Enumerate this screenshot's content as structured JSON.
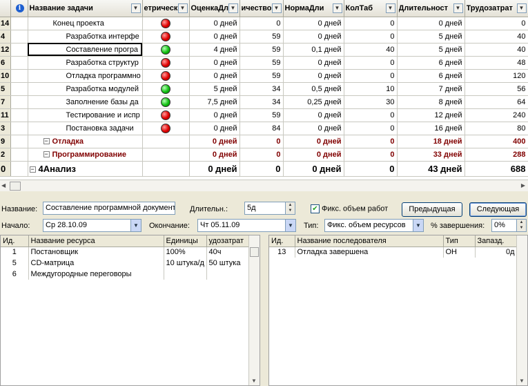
{
  "grid": {
    "columns": [
      {
        "label": ""
      },
      {
        "label": ""
      },
      {
        "label": "Название задачи"
      },
      {
        "label": "етрическ"
      },
      {
        "label": "ОценкаДл"
      },
      {
        "label": "ичествоР"
      },
      {
        "label": "НормаДли"
      },
      {
        "label": "КолТаб"
      },
      {
        "label": "Длительност"
      },
      {
        "label": "Трудозатрат"
      }
    ],
    "rows": [
      {
        "id": "14",
        "name": "Конец проекта",
        "indicator": "red",
        "ocenka": "0 дней",
        "kolichestvo": "0",
        "norma": "0 дней",
        "koltab": "0",
        "dlit": "0 дней",
        "trud": "0",
        "level": 1,
        "type": "task"
      },
      {
        "id": "4",
        "name": "Разработка интерфе",
        "indicator": "red",
        "ocenka": "0 дней",
        "kolichestvo": "59",
        "norma": "0 дней",
        "koltab": "0",
        "dlit": "5 дней",
        "trud": "40",
        "level": 2,
        "type": "task"
      },
      {
        "id": "12",
        "name": "Составление програ",
        "indicator": "green",
        "ocenka": "4 дней",
        "kolichestvo": "59",
        "norma": "0,1 дней",
        "koltab": "40",
        "dlit": "5 дней",
        "trud": "40",
        "level": 2,
        "type": "task",
        "selected": true
      },
      {
        "id": "6",
        "name": "Разработка структур",
        "indicator": "red",
        "ocenka": "0 дней",
        "kolichestvo": "59",
        "norma": "0 дней",
        "koltab": "0",
        "dlit": "6 дней",
        "trud": "48",
        "level": 2,
        "type": "task"
      },
      {
        "id": "10",
        "name": "Отладка программно",
        "indicator": "red",
        "ocenka": "0 дней",
        "kolichestvo": "59",
        "norma": "0 дней",
        "koltab": "0",
        "dlit": "6 дней",
        "trud": "120",
        "level": 2,
        "type": "task"
      },
      {
        "id": "5",
        "name": "Разработка модулей",
        "indicator": "green",
        "ocenka": "5 дней",
        "kolichestvo": "34",
        "norma": "0,5 дней",
        "koltab": "10",
        "dlit": "7 дней",
        "trud": "56",
        "level": 2,
        "type": "task"
      },
      {
        "id": "7",
        "name": "Заполнение базы да",
        "indicator": "green",
        "ocenka": "7,5 дней",
        "kolichestvo": "34",
        "norma": "0,25 дней",
        "koltab": "30",
        "dlit": "8 дней",
        "trud": "64",
        "level": 2,
        "type": "task"
      },
      {
        "id": "11",
        "name": "Тестирование и испр",
        "indicator": "red",
        "ocenka": "0 дней",
        "kolichestvo": "59",
        "norma": "0 дней",
        "koltab": "0",
        "dlit": "12 дней",
        "trud": "240",
        "level": 2,
        "type": "task"
      },
      {
        "id": "3",
        "name": "Постановка задачи",
        "indicator": "red",
        "ocenka": "0 дней",
        "kolichestvo": "84",
        "norma": "0 дней",
        "koltab": "0",
        "dlit": "16 дней",
        "trud": "80",
        "level": 2,
        "type": "task"
      },
      {
        "id": "9",
        "name": "Отладка",
        "indicator": "",
        "ocenka": "0 дней",
        "kolichestvo": "0",
        "norma": "0 дней",
        "koltab": "0",
        "dlit": "18 дней",
        "trud": "400",
        "level": 1,
        "type": "summary"
      },
      {
        "id": "2",
        "name": "Программирование",
        "indicator": "",
        "ocenka": "0 дней",
        "kolichestvo": "0",
        "norma": "0 дней",
        "koltab": "0",
        "dlit": "33 дней",
        "trud": "288",
        "level": 1,
        "type": "summary"
      },
      {
        "id": "0",
        "name": "4Анализ",
        "indicator": "",
        "ocenka": "0 дней",
        "kolichestvo": "0",
        "norma": "0 дней",
        "koltab": "0",
        "dlit": "43 дней",
        "trud": "688",
        "level": 0,
        "type": "big"
      }
    ]
  },
  "form": {
    "name_label": "Название:",
    "name_value": "Составление программной документ",
    "duration_label": "Длительн.:",
    "duration_value": "5д",
    "fixed_work_label": "Фикс. объем работ",
    "fixed_work_checked": true,
    "prev_button": "Предыдущая",
    "next_button": "Следующая",
    "start_label": "Начало:",
    "start_value": "Ср 28.10.09",
    "finish_label": "Окончание:",
    "finish_value": "Чт 05.11.09",
    "type_label": "Тип:",
    "type_value": "Фикс. объем ресурсов",
    "complete_label": "% завершения:",
    "complete_value": "0%"
  },
  "resources": {
    "headers": [
      "Ид.",
      "Название ресурса",
      "Единицы",
      "удозатрат"
    ],
    "rows": [
      [
        "1",
        "Постановщик",
        "100%",
        "40ч"
      ],
      [
        "5",
        "CD-матрица",
        "10 штука/д",
        "50 штука"
      ],
      [
        "6",
        "Междугородные переговоры",
        "",
        ""
      ]
    ]
  },
  "successors": {
    "headers": [
      "Ид.",
      "Название последователя",
      "Тип",
      "Запазд."
    ],
    "rows": [
      [
        "13",
        "Отладка завершена",
        "ОН",
        "0д"
      ]
    ]
  },
  "colors": {
    "summary_text": "#800000",
    "indicator_red": "#e00000",
    "indicator_green": "#10c010",
    "button_border": "#003c74"
  },
  "icons": {
    "info_column": "info-icon",
    "dropdown": "chevron-down-icon",
    "collapse": "minus-icon"
  }
}
